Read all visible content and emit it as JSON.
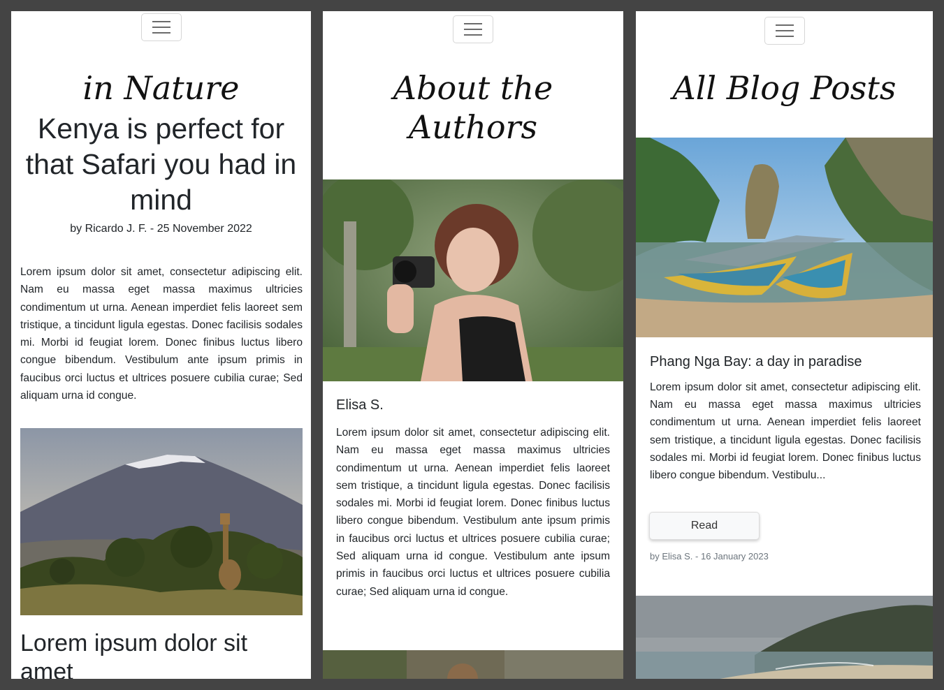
{
  "panel1": {
    "script_title": "in Nature",
    "headline": "Kenya is perfect for that Safari you had in mind",
    "byline": "by Ricardo J. F. - 25 November 2022",
    "body": "Lorem ipsum dolor sit amet, consectetur adipiscing elit. Nam eu massa eget massa maximus ultricies condimentum ut urna. Aenean imperdiet felis laoreet sem tristique, a tincidunt ligula egestas. Donec facilisis sodales mi. Morbi id feugiat lorem. Donec finibus luctus libero congue bibendum. Vestibulum ante ipsum primis in faucibus orci luctus et ultrices posuere cubilia curae; Sed aliquam urna id congue.",
    "subheading": "Lorem ipsum dolor sit amet"
  },
  "panel2": {
    "script_title": "About the Authors",
    "author_name": "Elisa S.",
    "author_bio": "Lorem ipsum dolor sit amet, consectetur adipiscing elit. Nam eu massa eget massa maximus ultricies condimentum ut urna. Aenean imperdiet felis laoreet sem tristique, a tincidunt ligula egestas. Donec facilisis sodales mi. Morbi id feugiat lorem. Donec finibus luctus libero congue bibendum. Vestibulum ante ipsum primis in faucibus orci luctus et ultrices posuere cubilia curae; Sed aliquam urna id congue. Vestibulum ante ipsum primis in faucibus orci luctus et ultrices posuere cubilia curae; Sed aliquam urna id congue."
  },
  "panel3": {
    "script_title": "All Blog Posts",
    "post_title": "Phang Nga Bay: a day in paradise",
    "post_excerpt": "Lorem ipsum dolor sit amet, consectetur adipiscing elit. Nam eu massa eget massa maximus ultricies condimentum ut urna. Aenean imperdiet felis laoreet sem tristique, a tincidunt ligula egestas. Donec facilisis sodales mi. Morbi id feugiat lorem. Donec finibus luctus libero congue bibendum. Vestibulu...",
    "read_button": "Read",
    "post_meta": "by Elisa S. - 16 January 2023"
  },
  "icons": {
    "menu": "hamburger-menu-icon"
  },
  "colors": {
    "frame_background": "#444444",
    "panel_background": "#ffffff",
    "text": "#212529",
    "muted_text": "#6c757d",
    "button_background": "#f8f9fa"
  }
}
